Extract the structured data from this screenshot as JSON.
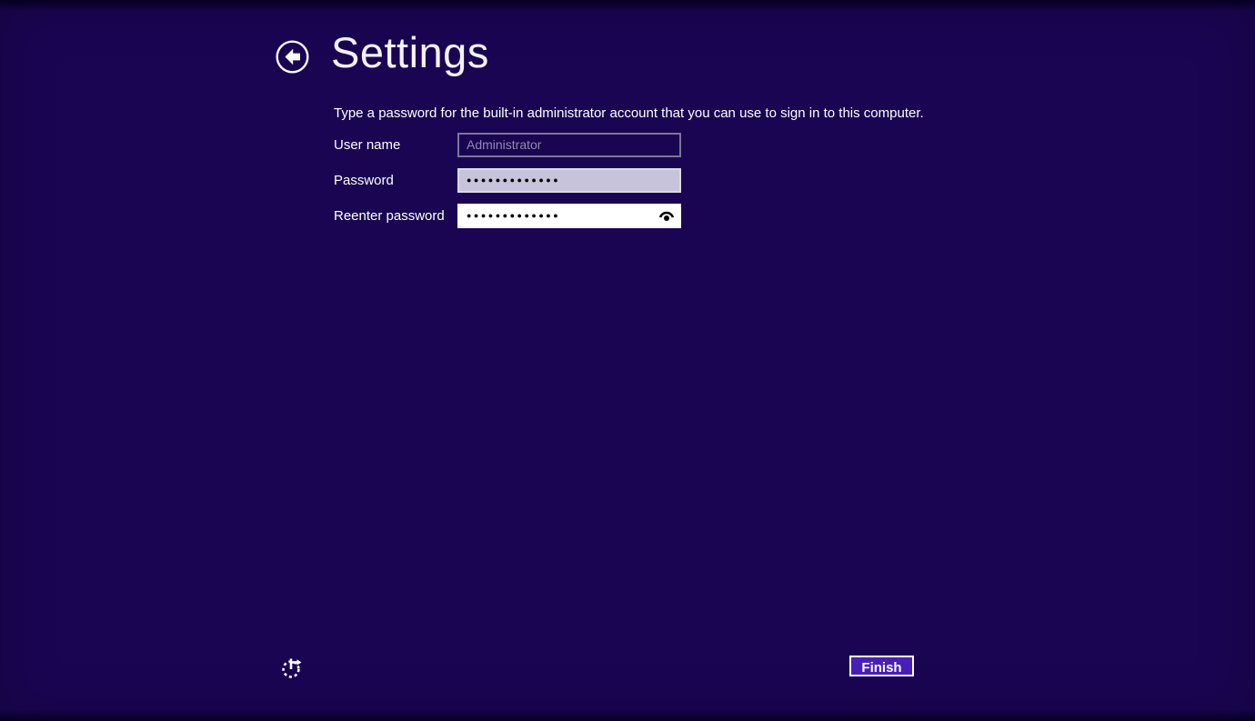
{
  "header": {
    "title": "Settings",
    "back_icon": "back-arrow-circle"
  },
  "main": {
    "description": "Type a password for the built-in administrator account that you can use to sign in to this computer.",
    "form": {
      "username": {
        "label": "User name",
        "placeholder": "Administrator",
        "value": "",
        "disabled": true
      },
      "password": {
        "label": "Password",
        "mask": "●●●●●●●●●●●●●",
        "selected": true
      },
      "reenter": {
        "label": "Reenter password",
        "mask": "●●●●●●●●●●●●●",
        "reveal_icon": "password-reveal-eye"
      }
    }
  },
  "footer": {
    "progress_icon": "progress-spinner",
    "finish_label": "Finish"
  },
  "colors": {
    "background": "#1a0553",
    "accent_button": "#4a1fb8",
    "password_field_bg": "#c6c3da",
    "reenter_field_bg": "#ffffff",
    "disabled_border": "#7d7699",
    "disabled_text": "#918ba9",
    "text": "#ffffff"
  }
}
